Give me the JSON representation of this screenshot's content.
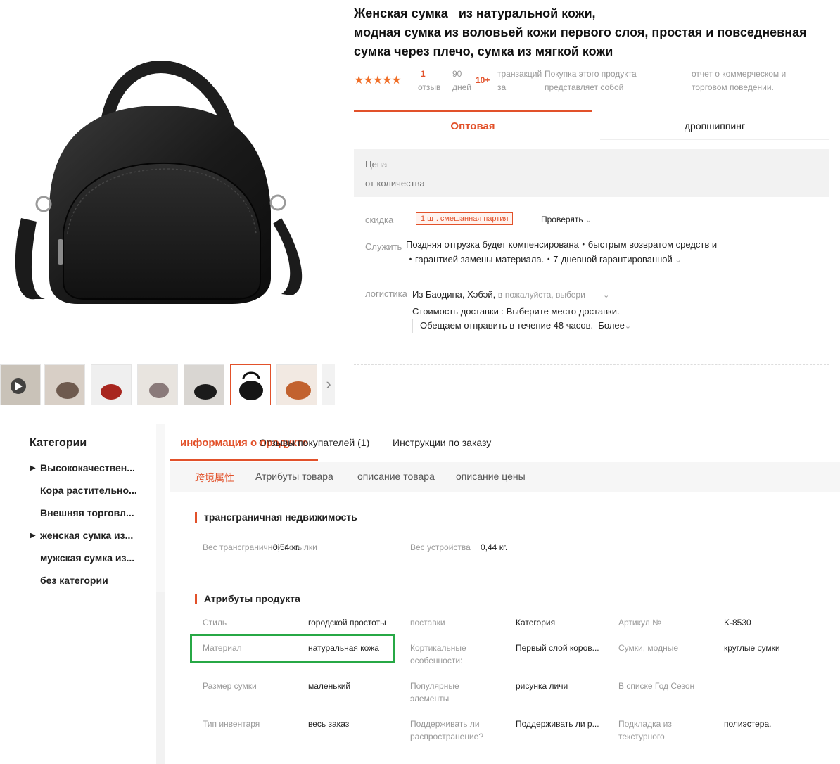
{
  "title": {
    "line1a": "Женская сумка",
    "line1b": "из натуральной кожи,",
    "line2": "модная сумка из воловьей кожи первого слоя, простая и повседневная",
    "line3": "сумка через плечо, сумка из мягкой кожи"
  },
  "meta": {
    "stars": "★★★★★",
    "reviews_count": "1",
    "reviews_label": "отзыв",
    "days_num": "90",
    "days_label": "дней",
    "tx_count": "10+",
    "tx_label_1": "транзакций",
    "tx_label_2": "за",
    "buy_1": "Покупка этого продукта",
    "buy_2": "представляет собой",
    "report_1": "отчет о коммерческом и",
    "report_2": "торговом поведении."
  },
  "tabs": {
    "wholesale": "Оптовая",
    "dropship": "дропшиппинг"
  },
  "price": {
    "label": "Цена",
    "qty": "от количества"
  },
  "discount": {
    "label": "скидка",
    "badge": "1 шт. смешанная партия",
    "check": "Проверять"
  },
  "service": {
    "label": "Служить",
    "line1": "Поздняя отгрузка будет компенсирована・быстрым возвратом средств и",
    "line2": "・гарантией замены материала.・7-дневной гарантированной"
  },
  "logistics": {
    "label": "логистика",
    "from": "Из Баодина, Хэбэй,",
    "to_prefix": "в",
    "to_hint": "пожалуйста, выбери",
    "cost": "Стоимость доставки : Выберите место доставки.",
    "promise": "Обещаем отправить в течение 48 часов.",
    "more": "Более"
  },
  "categories": {
    "heading": "Категории",
    "items": [
      "Высококачествен...",
      "Кора растительно...",
      "Внешняя торговл...",
      "женская сумка из...",
      "мужская сумка из...",
      "без категории"
    ]
  },
  "bottom_tabs": {
    "info": "информация о продукте",
    "reviews": "Отзывы покупателей (1)",
    "order": "Инструкции по заказу"
  },
  "sub_tabs": [
    "跨境属性",
    "Атрибуты товара",
    "описание товара",
    "описание цены"
  ],
  "cross_border": {
    "heading": "трансграничная недвижимость",
    "k1": "Вес трансграничной посылки",
    "v1": "0,54 кг.",
    "k2": "Вес устройства",
    "v2": "0,44 кг."
  },
  "attributes": {
    "heading": "Атрибуты продукта",
    "rows": [
      [
        "Стиль",
        "городской простоты",
        "поставки",
        "Категория",
        "Артикул №",
        "K-8530"
      ],
      [
        "Материал",
        "натуральная кожа",
        "Кортикальные особенности:",
        "Первый слой коров...",
        "Сумки, модные",
        "круглые сумки"
      ],
      [
        "Размер сумки",
        "маленький",
        "Популярные элементы",
        "рисунка личи",
        "В списке Год Сезон",
        ""
      ],
      [
        "Тип инвентаря",
        "весь заказ",
        "Поддерживать ли распространение?",
        "Поддерживать ли р...",
        "Подкладка из текстурного",
        "полиэстера."
      ]
    ]
  },
  "colors": {
    "accent": "#e2512a",
    "highlight": "#27a845"
  }
}
